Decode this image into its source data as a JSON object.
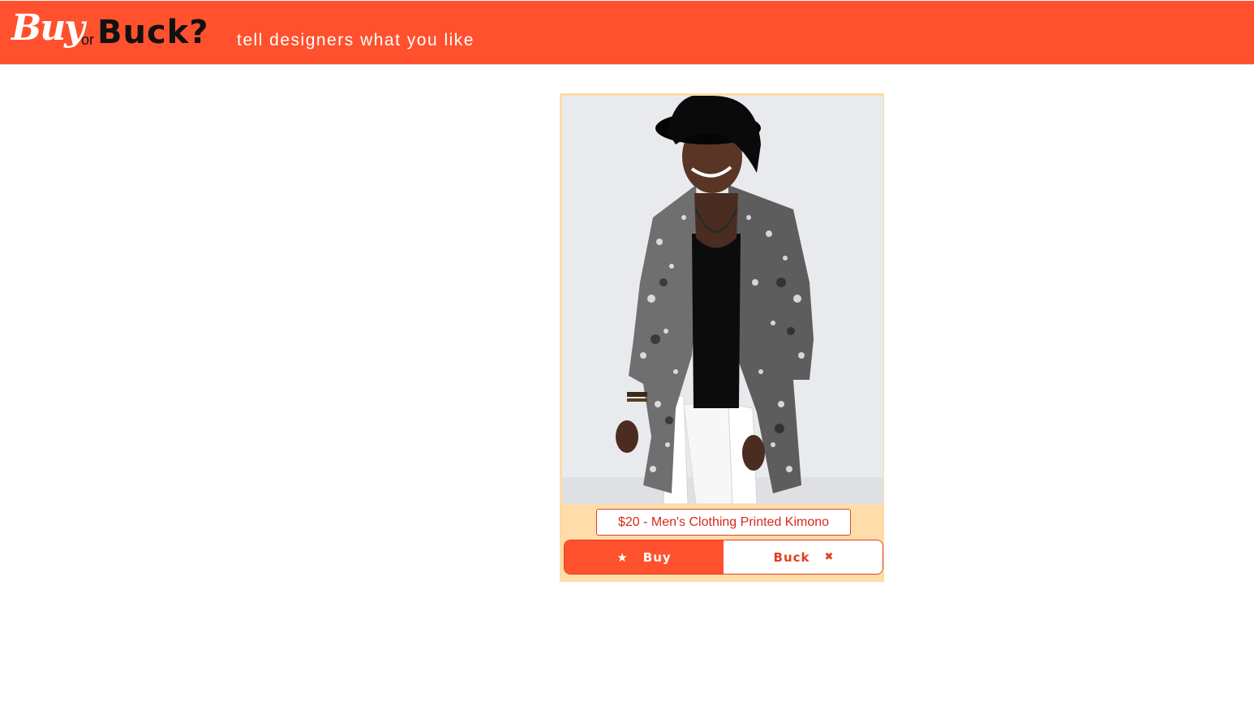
{
  "header": {
    "logo_buy": "Buy",
    "logo_or": "or",
    "logo_buck": "Buck?",
    "tagline": "tell designers what you like",
    "bg_color": "#ff512d"
  },
  "product": {
    "label": "$20 - Men's Clothing Printed Kimono",
    "image_alt": "product photo"
  },
  "vote": {
    "buy_label": "Buy",
    "buy_icon": "star-icon",
    "buck_label": "Buck",
    "buck_icon": "close-icon"
  }
}
